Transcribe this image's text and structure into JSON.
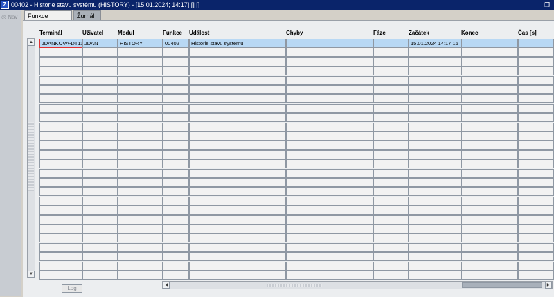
{
  "window": {
    "title": "00402 - Historie stavu systému (HISTORY) - [15.01.2024; 14:17]  [] []",
    "app_icon": "app-logo-icon",
    "restore_icon": "restore-window-icon"
  },
  "nav": {
    "label": "Nav"
  },
  "tabs": [
    {
      "label": "Funkce",
      "active": true
    },
    {
      "label": "Žurnál",
      "active": false
    }
  ],
  "grid": {
    "columns": [
      "Terminál",
      "Uživatel",
      "Modul",
      "Funkce",
      "Událost",
      "Chyby",
      "Fáze",
      "Začátek",
      "Konec",
      "Čas [s]"
    ],
    "rows": [
      [
        "JDANKOVA-DT11",
        "JDAN",
        "HISTORY",
        "00402",
        "Historie stavu systému",
        "",
        "",
        "15.01.2024 14:17:16",
        "",
        ""
      ]
    ],
    "selected_row": 0
  },
  "footer": {
    "log_label": "Log"
  }
}
